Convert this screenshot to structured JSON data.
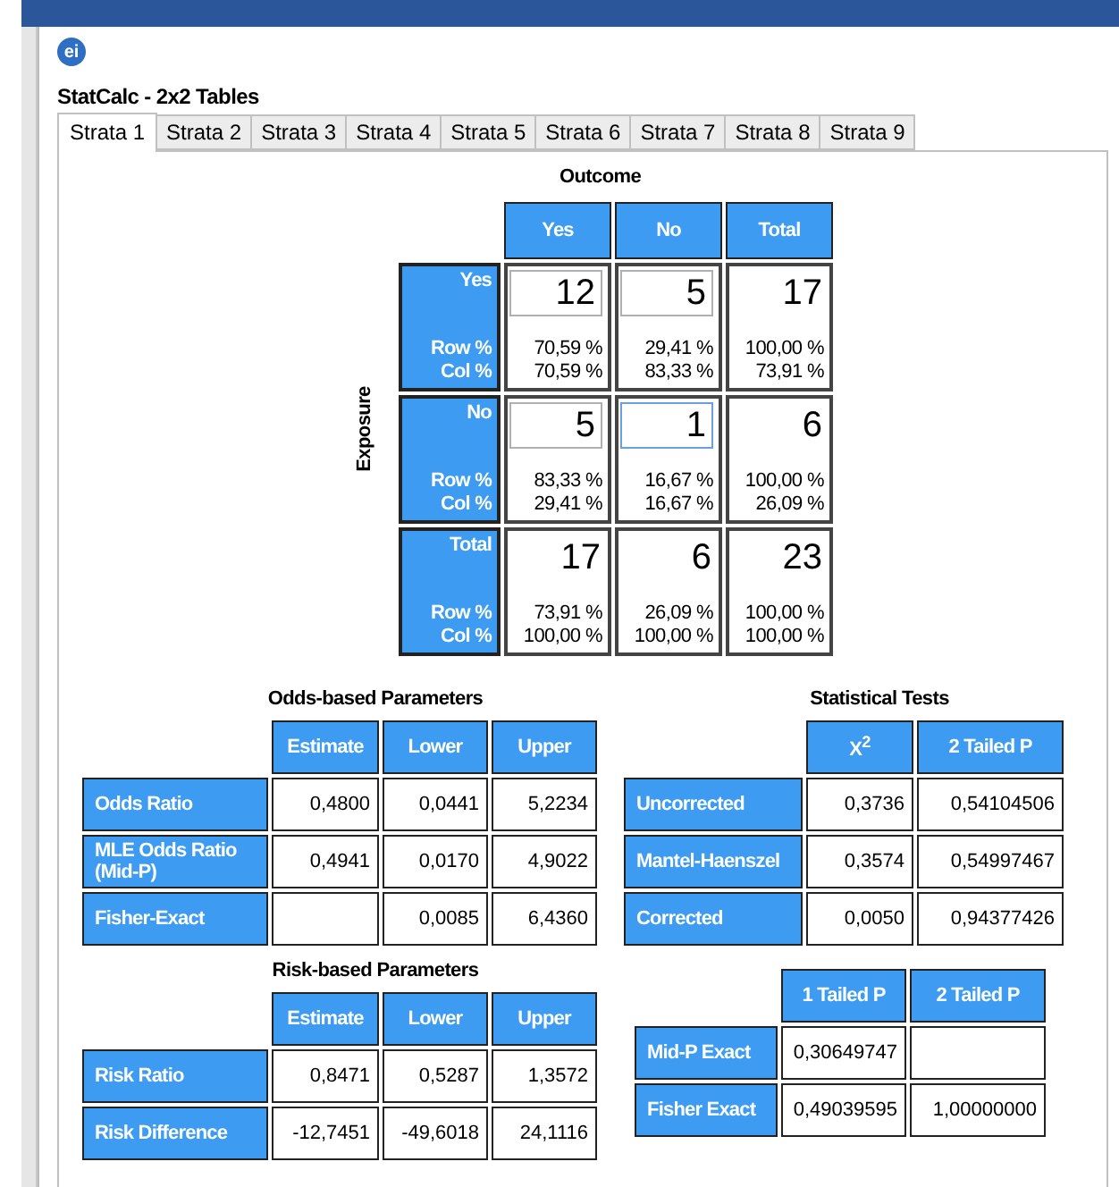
{
  "app_icon": {
    "text": "ei"
  },
  "window": {
    "title": "StatCalc - 2x2 Tables"
  },
  "tabs": [
    {
      "label": "Strata 1",
      "selected": true
    },
    {
      "label": "Strata 2",
      "selected": false
    },
    {
      "label": "Strata 3",
      "selected": false
    },
    {
      "label": "Strata 4",
      "selected": false
    },
    {
      "label": "Strata 5",
      "selected": false
    },
    {
      "label": "Strata 6",
      "selected": false
    },
    {
      "label": "Strata 7",
      "selected": false
    },
    {
      "label": "Strata 8",
      "selected": false
    },
    {
      "label": "Strata 9",
      "selected": false
    }
  ],
  "table_2x2": {
    "outcome_label": "Outcome",
    "exposure_label": "Exposure",
    "columns": [
      "Yes",
      "No",
      "Total"
    ],
    "rows": [
      {
        "label": "Yes",
        "row_pct_label": "Row %",
        "col_pct_label": "Col %",
        "cells": [
          {
            "kind": "input",
            "value": "12",
            "focused": false,
            "row_pct": "70,59 %",
            "col_pct": "70,59 %"
          },
          {
            "kind": "input",
            "value": "5",
            "focused": false,
            "row_pct": "29,41 %",
            "col_pct": "83,33 %"
          },
          {
            "kind": "total",
            "value": "17",
            "row_pct": "100,00 %",
            "col_pct": "73,91 %"
          }
        ]
      },
      {
        "label": "No",
        "row_pct_label": "Row %",
        "col_pct_label": "Col %",
        "cells": [
          {
            "kind": "input",
            "value": "5",
            "focused": false,
            "row_pct": "83,33 %",
            "col_pct": "29,41 %"
          },
          {
            "kind": "input",
            "value": "1",
            "focused": true,
            "row_pct": "16,67 %",
            "col_pct": "16,67 %"
          },
          {
            "kind": "total",
            "value": "6",
            "row_pct": "100,00 %",
            "col_pct": "26,09 %"
          }
        ]
      },
      {
        "label": "Total",
        "row_pct_label": "Row %",
        "col_pct_label": "Col %",
        "cells": [
          {
            "kind": "total",
            "value": "17",
            "row_pct": "73,91 %",
            "col_pct": "100,00 %"
          },
          {
            "kind": "total",
            "value": "6",
            "row_pct": "26,09 %",
            "col_pct": "100,00 %"
          },
          {
            "kind": "total",
            "value": "23",
            "row_pct": "100,00 %",
            "col_pct": "100,00 %"
          }
        ]
      }
    ]
  },
  "odds_parameters": {
    "title": "Odds-based Parameters",
    "columns": [
      "Estimate",
      "Lower",
      "Upper"
    ],
    "rows": [
      {
        "label": "Odds Ratio",
        "estimate": "0,4800",
        "lower": "0,0441",
        "upper": "5,2234"
      },
      {
        "label": "MLE Odds Ratio (Mid-P)",
        "estimate": "0,4941",
        "lower": "0,0170",
        "upper": "4,9022"
      },
      {
        "label": "Fisher-Exact",
        "lower": "0,0085",
        "upper": "6,4360"
      }
    ]
  },
  "statistical_tests": {
    "title": "Statistical Tests",
    "columns": [
      "X$^{2}$",
      "2 Tailed P"
    ],
    "rows": [
      {
        "label": "Uncorrected",
        "chi_square": "0,3736",
        "two_tailed_p": "0,54104506"
      },
      {
        "label": "Mantel-Haenszel",
        "chi_square": "0,3574",
        "two_tailed_p": "0,54997467"
      },
      {
        "label": "Corrected",
        "chi_square": "0,0050",
        "two_tailed_p": "0,94377426"
      }
    ]
  },
  "risk_parameters": {
    "title": "Risk-based Parameters",
    "columns": [
      "Estimate",
      "Lower",
      "Upper"
    ],
    "rows": [
      {
        "label": "Risk Ratio",
        "estimate": "0,8471",
        "lower": "0,5287",
        "upper": "1,3572"
      },
      {
        "label": "Risk Difference",
        "estimate": "-12,7451",
        "lower": "-49,6018",
        "upper": "24,1116"
      }
    ]
  },
  "exact_tests": {
    "columns": [
      "1 Tailed P",
      "2 Tailed P"
    ],
    "rows": [
      {
        "label": "Mid-P Exact",
        "one_tailed_p": "0,30649747"
      },
      {
        "label": "Fisher Exact",
        "one_tailed_p": "0,49039595",
        "two_tailed_p": "1,00000000"
      }
    ]
  }
}
